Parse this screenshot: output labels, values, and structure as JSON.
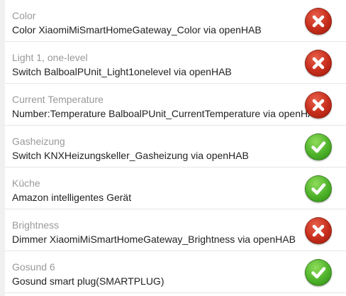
{
  "devices": [
    {
      "title": "Color",
      "description": "Color XiaomiMiSmartHomeGateway_Color via openHAB",
      "status": "error",
      "status_icon": "x-icon"
    },
    {
      "title": "Light 1, one-level",
      "description": "Switch BalboalPUnit_Light1onelevel via openHAB",
      "status": "error",
      "status_icon": "x-icon"
    },
    {
      "title": "Current Temperature",
      "description": "Number:Temperature BalboalPUnit_CurrentTemperature via openHAB",
      "status": "error",
      "status_icon": "x-icon"
    },
    {
      "title": "Gasheizung",
      "description": "Switch KNXHeizungskeller_Gasheizung via openHAB",
      "status": "ok",
      "status_icon": "check-icon"
    },
    {
      "title": "Küche",
      "description": "Amazon intelligentes Gerät",
      "status": "ok",
      "status_icon": "check-icon"
    },
    {
      "title": "Brightness",
      "description": "Dimmer XiaomiMiSmartHomeGateway_Brightness via openHAB",
      "status": "error",
      "status_icon": "x-icon"
    },
    {
      "title": "Gosund 6",
      "description": "Gosund smart plug(SMARTPLUG)",
      "status": "ok",
      "status_icon": "check-icon"
    }
  ],
  "colors": {
    "error": "#c62d1b",
    "ok": "#4eb22a",
    "title_text": "#999999",
    "description_text": "#222222"
  }
}
